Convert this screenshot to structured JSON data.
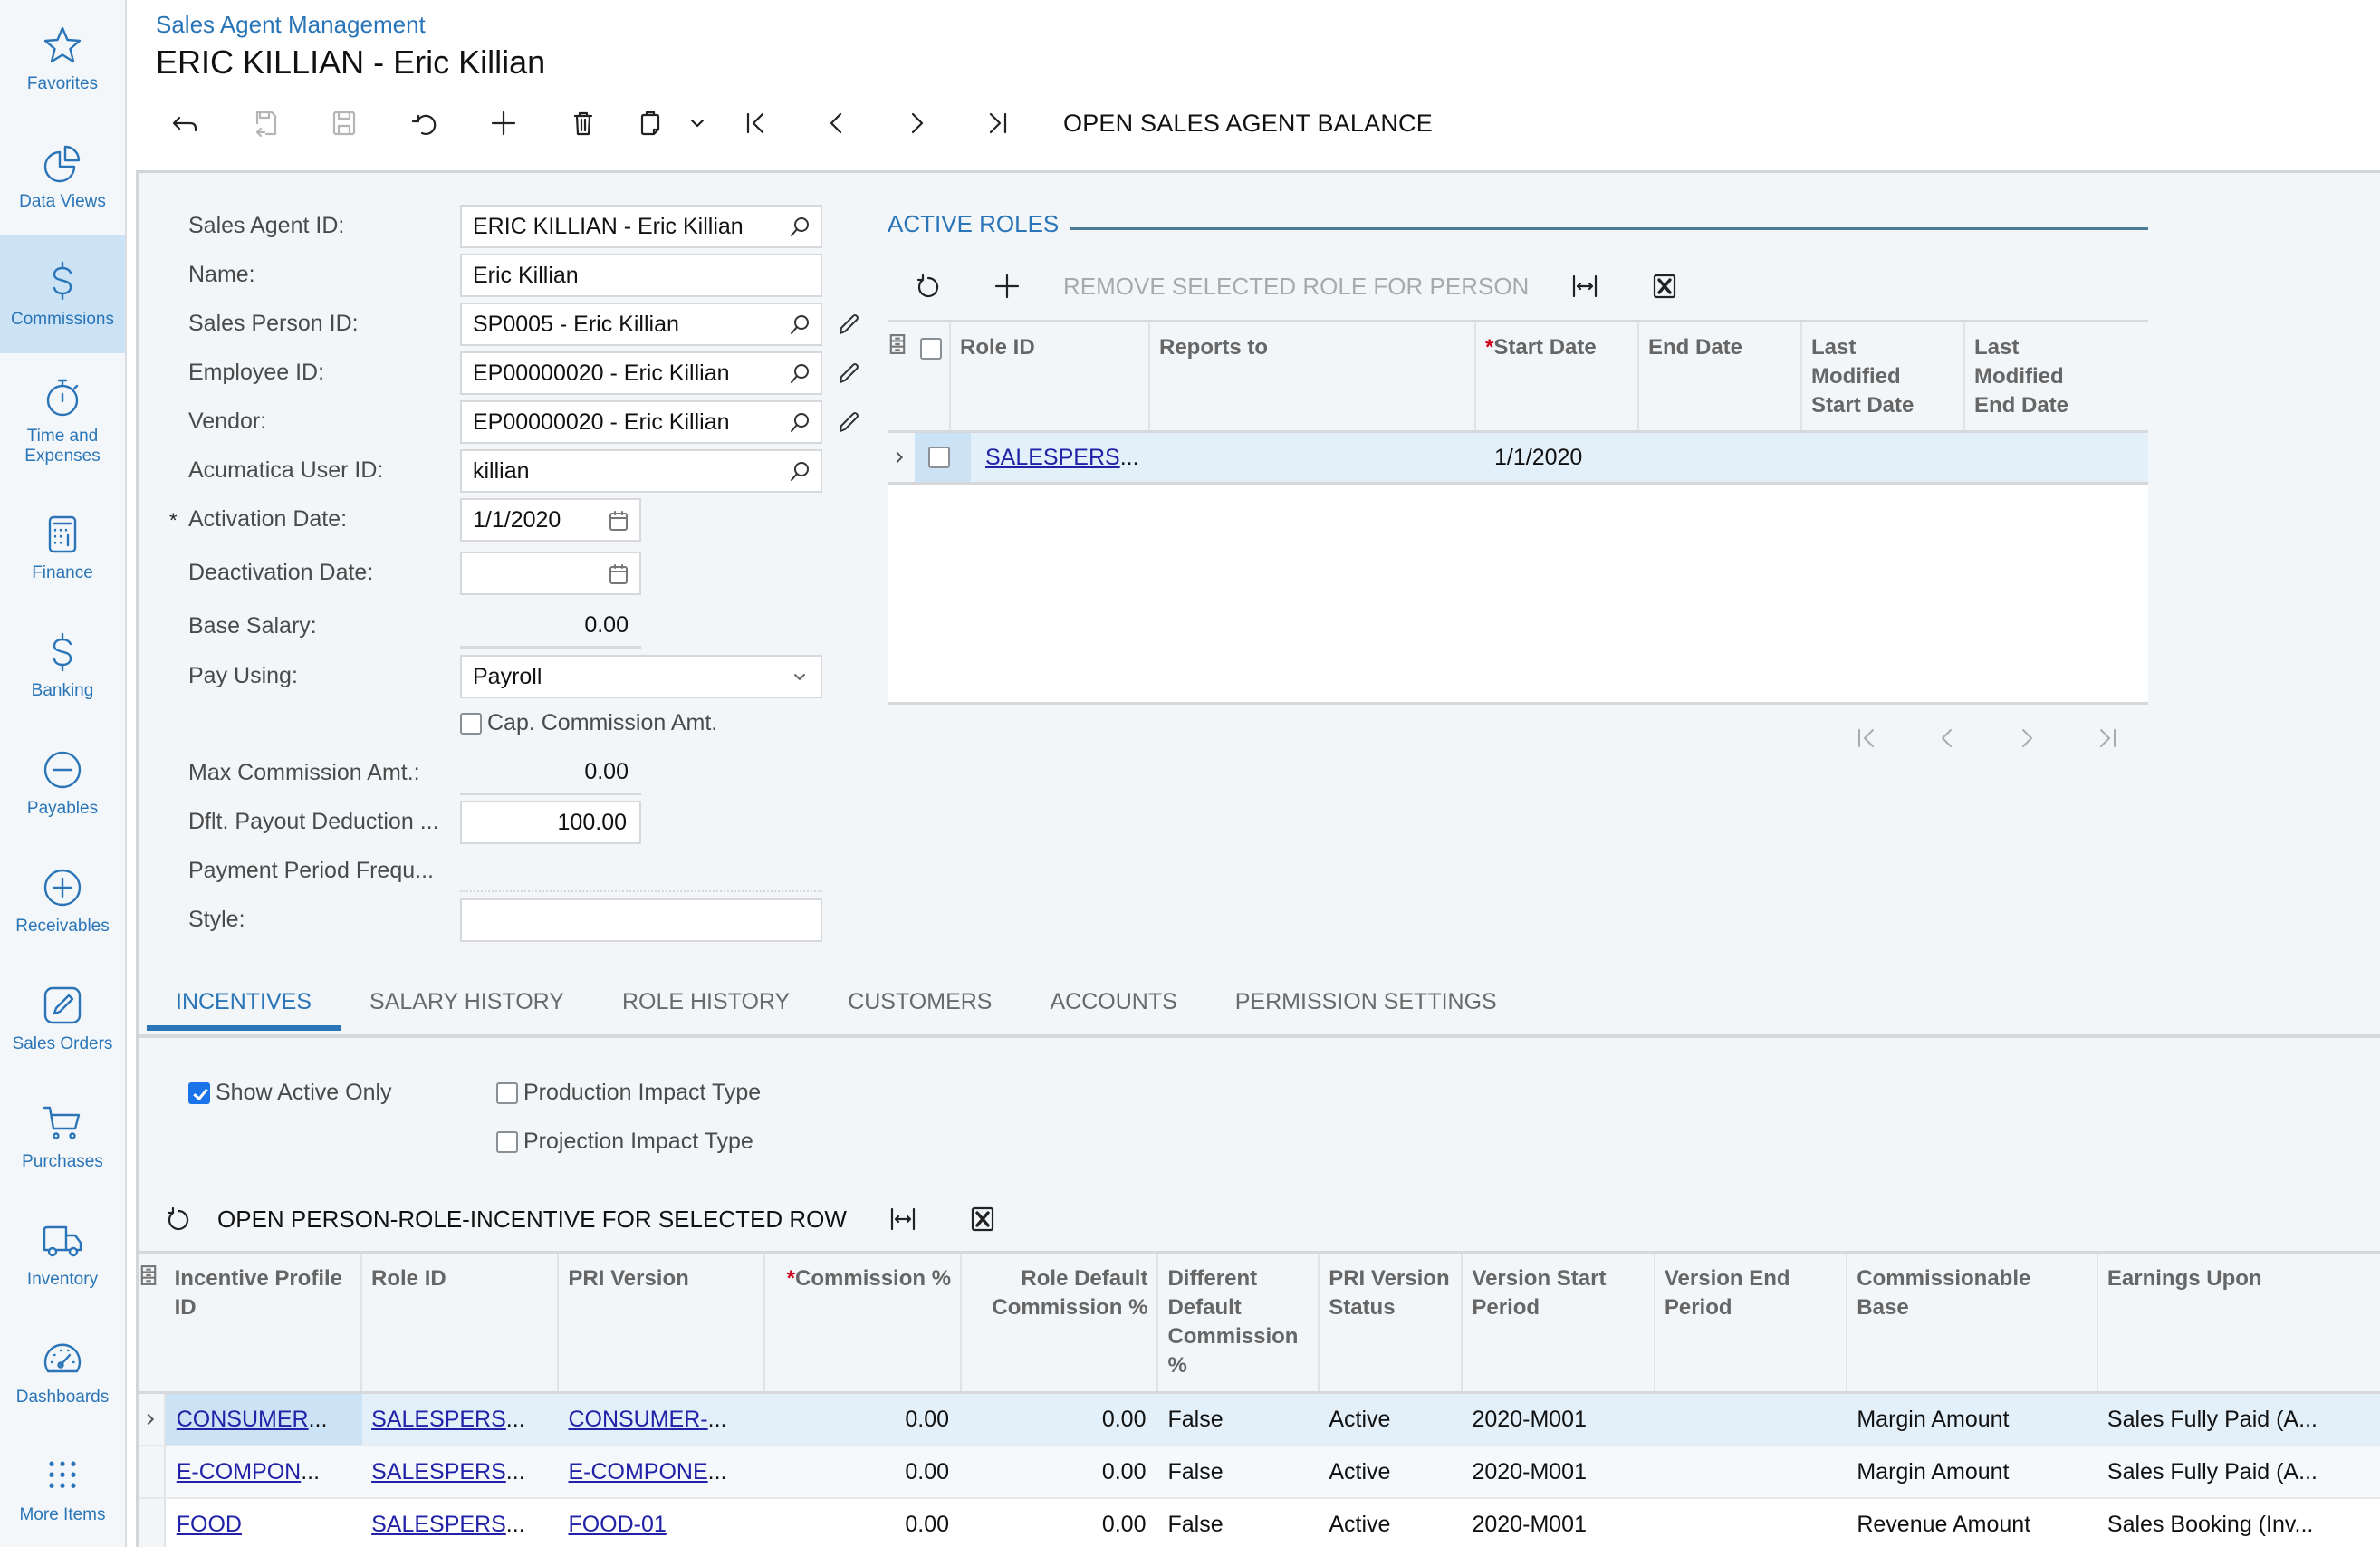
{
  "sidebar": {
    "items": [
      {
        "label": "Favorites",
        "icon": "star-icon"
      },
      {
        "label": "Data Views",
        "icon": "pie-chart-icon"
      },
      {
        "label": "Commissions",
        "icon": "dollar-icon",
        "active": true
      },
      {
        "label": "Time and Expenses",
        "icon": "stopwatch-icon"
      },
      {
        "label": "Finance",
        "icon": "calculator-icon"
      },
      {
        "label": "Banking",
        "icon": "dollar-icon"
      },
      {
        "label": "Payables",
        "icon": "minus-circle-icon"
      },
      {
        "label": "Receivables",
        "icon": "plus-circle-icon"
      },
      {
        "label": "Sales Orders",
        "icon": "pencil-square-icon"
      },
      {
        "label": "Purchases",
        "icon": "cart-icon"
      },
      {
        "label": "Inventory",
        "icon": "truck-icon"
      },
      {
        "label": "Dashboards",
        "icon": "gauge-icon"
      },
      {
        "label": "More Items",
        "icon": "grid-dots-icon"
      }
    ]
  },
  "header": {
    "breadcrumb": "Sales Agent Management",
    "title": "ERIC KILLIAN - Eric Killian",
    "toolbar_action": "OPEN SALES AGENT BALANCE"
  },
  "form": {
    "sales_agent_id": {
      "label": "Sales Agent ID:",
      "value": "ERIC KILLIAN - Eric Killian"
    },
    "name": {
      "label": "Name:",
      "value": "Eric Killian"
    },
    "sales_person_id": {
      "label": "Sales Person ID:",
      "value": "SP0005 - Eric Killian"
    },
    "employee_id": {
      "label": "Employee ID:",
      "value": "EP00000020 - Eric Killian"
    },
    "vendor": {
      "label": "Vendor:",
      "value": "EP00000020 - Eric Killian"
    },
    "acumatica_user_id": {
      "label": "Acumatica User ID:",
      "value": "killian"
    },
    "activation_date": {
      "label": "Activation Date:",
      "value": "1/1/2020",
      "required_mark": "*"
    },
    "deactivation_date": {
      "label": "Deactivation Date:",
      "value": ""
    },
    "base_salary": {
      "label": "Base Salary:",
      "value": "0.00"
    },
    "pay_using": {
      "label": "Pay Using:",
      "value": "Payroll"
    },
    "cap_commission": {
      "label": "Cap. Commission Amt.",
      "checked": false
    },
    "max_commission": {
      "label": "Max Commission Amt.:",
      "value": "0.00"
    },
    "payout_deduction": {
      "label": "Dflt. Payout Deduction ...",
      "value": "100.00"
    },
    "payment_period": {
      "label": "Payment Period Frequ...",
      "value": ""
    },
    "style": {
      "label": "Style:",
      "value": ""
    }
  },
  "active_roles": {
    "title": "ACTIVE ROLES",
    "remove_label": "REMOVE SELECTED ROLE FOR PERSON",
    "columns": [
      "Role ID",
      "Reports to",
      "Start Date",
      "End Date",
      "Last Modified Start Date",
      "Last Modified End Date"
    ],
    "rows": [
      {
        "role_id": "SALESPERS",
        "reports_to": "",
        "start_date": "1/1/2020",
        "end_date": "",
        "lm_start": "",
        "lm_end": ""
      }
    ]
  },
  "tabs": [
    {
      "label": "INCENTIVES",
      "active": true
    },
    {
      "label": "SALARY HISTORY"
    },
    {
      "label": "ROLE HISTORY"
    },
    {
      "label": "CUSTOMERS"
    },
    {
      "label": "ACCOUNTS"
    },
    {
      "label": "PERMISSION SETTINGS"
    }
  ],
  "incentives": {
    "show_active_only": {
      "label": "Show Active Only",
      "checked": true
    },
    "production_impact": {
      "label": "Production Impact Type",
      "checked": false
    },
    "projection_impact": {
      "label": "Projection Impact Type",
      "checked": false
    },
    "open_action": "OPEN PERSON-ROLE-INCENTIVE FOR SELECTED ROW",
    "columns": [
      "Incentive Profile ID",
      "Role ID",
      "PRI Version",
      "Commission %",
      "Role Default Commission %",
      "Different Default Commission %",
      "PRI Version Status",
      "Version Start Period",
      "Version End Period",
      "Commissionable Base",
      "Earnings Upon"
    ],
    "rows": [
      {
        "profile": "CONSUMER",
        "role": "SALESPERS",
        "version": "CONSUMER-",
        "commission": "0.00",
        "role_default": "0.00",
        "different": "False",
        "status": "Active",
        "start_period": "2020-M001",
        "end_period": "",
        "base": "Margin Amount",
        "earnings": "Sales Fully Paid (A..."
      },
      {
        "profile": "E-COMPON",
        "role": "SALESPERS",
        "version": "E-COMPONE",
        "commission": "0.00",
        "role_default": "0.00",
        "different": "False",
        "status": "Active",
        "start_period": "2020-M001",
        "end_period": "",
        "base": "Margin Amount",
        "earnings": "Sales Fully Paid (A..."
      },
      {
        "profile": "FOOD",
        "role": "SALESPERS",
        "version": "FOOD-01",
        "commission": "0.00",
        "role_default": "0.00",
        "different": "False",
        "status": "Active",
        "start_period": "2020-M001",
        "end_period": "",
        "base": "Revenue Amount",
        "earnings": "Sales Booking (Inv..."
      }
    ]
  },
  "colors": {
    "accent": "#2a75b8",
    "link": "#2222a8",
    "required": "#d0021b",
    "selected_row": "#e3eff9"
  }
}
